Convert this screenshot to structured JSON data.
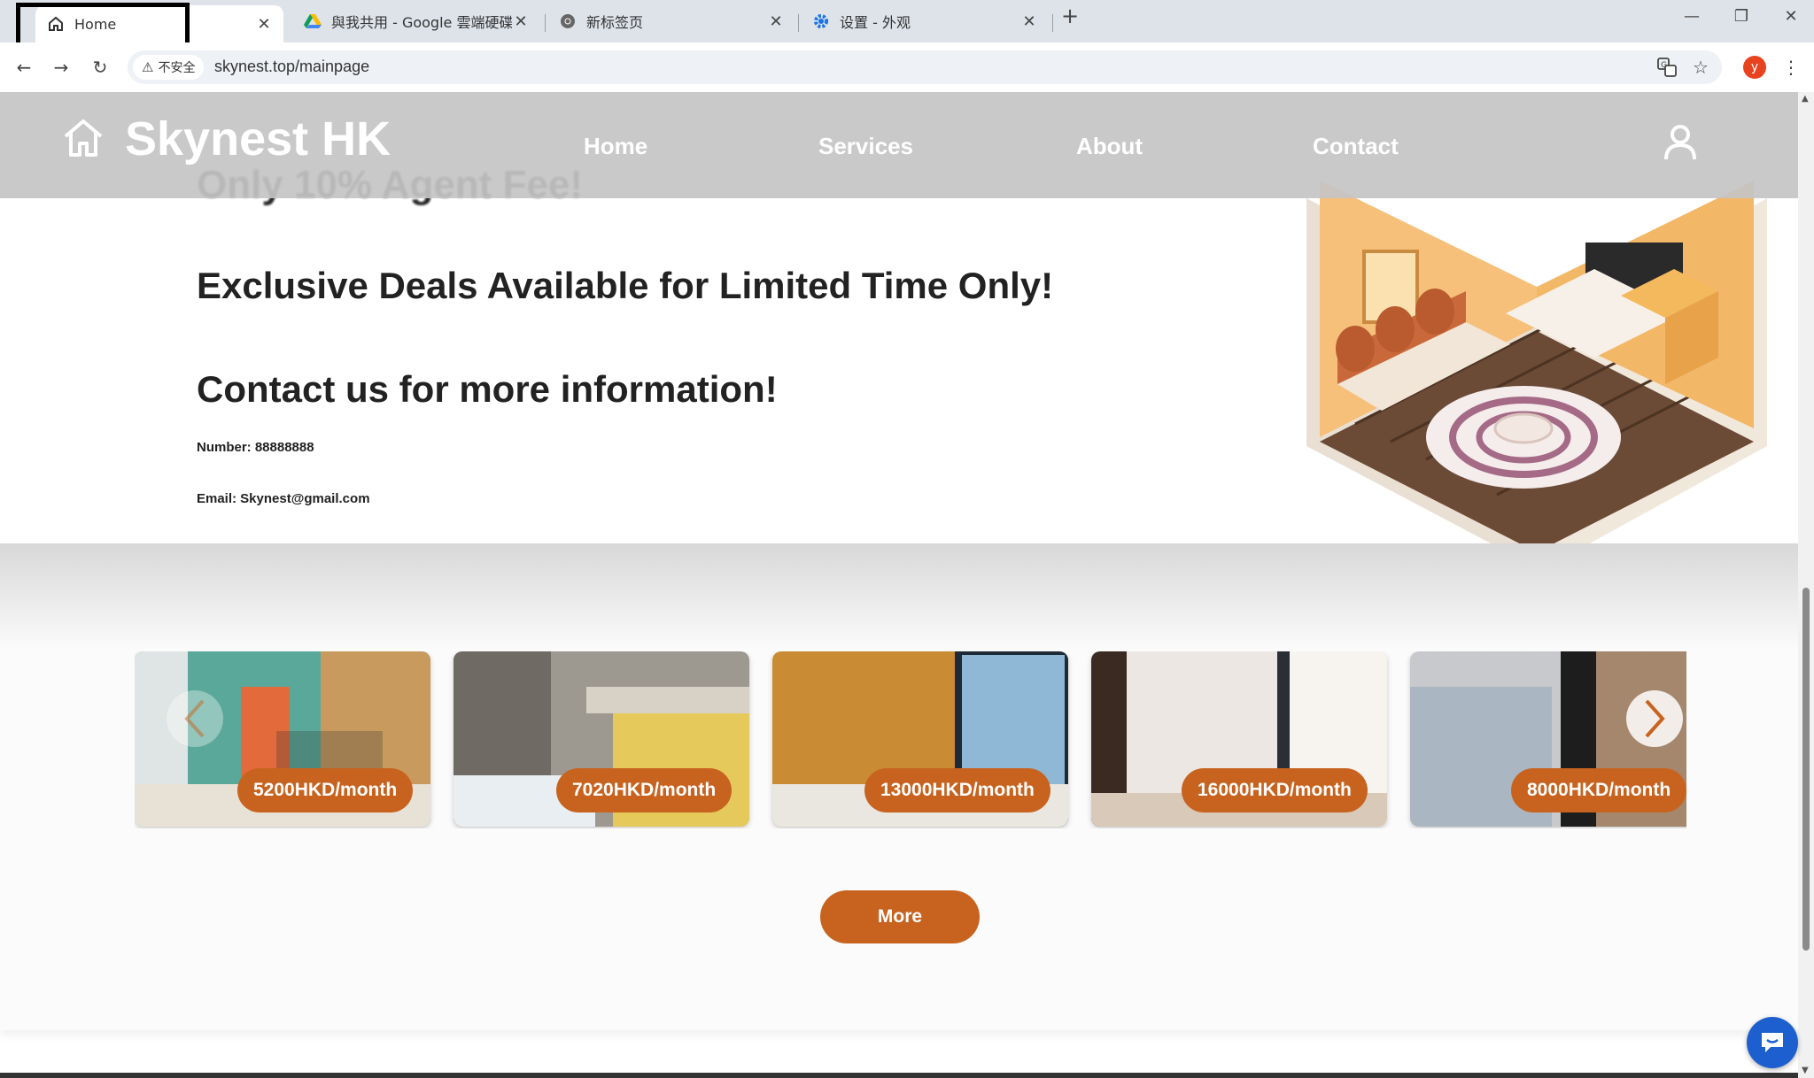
{
  "browser": {
    "tabs": [
      {
        "title": "Home",
        "icon": "home-icon",
        "active": true
      },
      {
        "title": "與我共用 - Google 雲端硬碟",
        "icon": "google-drive-icon",
        "active": false
      },
      {
        "title": "新标签页",
        "icon": "chrome-icon",
        "active": false
      },
      {
        "title": "设置 - 外观",
        "icon": "settings-gear-icon",
        "active": false
      }
    ],
    "security_label": "不安全",
    "url": "skynest.top/mainpage",
    "profile_initial": "y"
  },
  "site": {
    "brand": "Skynest HK",
    "nav": [
      "Home",
      "Services",
      "About",
      "Contact"
    ]
  },
  "hero": {
    "cut_off_line": "Only 10% Agent Fee!",
    "headline_deals": "Exclusive Deals Available for Limited Time Only!",
    "headline_contact": "Contact us for more information!",
    "number_line": "Number: 88888888",
    "email_line": "Email: Skynest@gmail.com"
  },
  "listings": [
    {
      "price": "5200HKD/month"
    },
    {
      "price": "7020HKD/month"
    },
    {
      "price": "13000HKD/month"
    },
    {
      "price": "16000HKD/month"
    },
    {
      "price": "8000HKD/month"
    }
  ],
  "more_label": "More",
  "colors": {
    "accent": "#c8631f",
    "header": "#c4c4c4",
    "chat": "#1e5fcf"
  }
}
